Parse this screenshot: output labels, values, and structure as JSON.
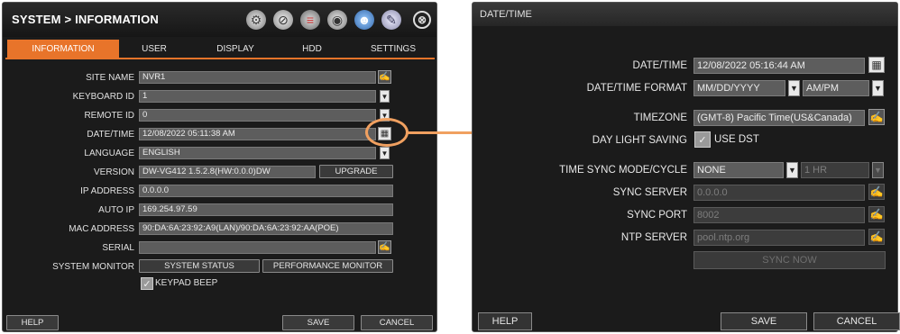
{
  "left": {
    "title": "SYSTEM > INFORMATION",
    "toolbar_icons": [
      "gear-icon",
      "network-icon",
      "database-icon",
      "record-icon",
      "user-icon",
      "tools-icon"
    ],
    "close_symbol": "⊗",
    "tabs": [
      {
        "label": "INFORMATION",
        "active": true
      },
      {
        "label": "USER",
        "active": false
      },
      {
        "label": "DISPLAY",
        "active": false
      },
      {
        "label": "HDD",
        "active": false
      },
      {
        "label": "SETTINGS",
        "active": false
      }
    ],
    "rows": {
      "site_name": {
        "label": "SITE NAME",
        "value": "NVR1"
      },
      "keyboard_id": {
        "label": "KEYBOARD ID",
        "value": "1"
      },
      "remote_id": {
        "label": "REMOTE ID",
        "value": "0"
      },
      "datetime": {
        "label": "DATE/TIME",
        "value": "12/08/2022 05:11:38 AM"
      },
      "language": {
        "label": "LANGUAGE",
        "value": "ENGLISH"
      },
      "version": {
        "label": "VERSION",
        "value": "DW-VG412 1.5.2.8(HW:0.0.0)DW",
        "button": "UPGRADE"
      },
      "ip_address": {
        "label": "IP ADDRESS",
        "value": "0.0.0.0"
      },
      "auto_ip": {
        "label": "AUTO IP",
        "value": "169.254.97.59"
      },
      "mac_address": {
        "label": "MAC ADDRESS",
        "value": "90:DA:6A:23:92:A9(LAN)/90:DA:6A:23:92:AA(POE)"
      },
      "serial": {
        "label": "SERIAL",
        "value": ""
      },
      "system_monitor": {
        "label": "SYSTEM MONITOR",
        "btn1": "SYSTEM STATUS",
        "btn2": "PERFORMANCE MONITOR"
      },
      "keypad_beep": {
        "label": "KEYPAD BEEP",
        "checked": true
      }
    },
    "footer": {
      "help": "HELP",
      "save": "SAVE",
      "cancel": "CANCEL"
    }
  },
  "right": {
    "title": "DATE/TIME",
    "rows": {
      "datetime": {
        "label": "DATE/TIME",
        "value": "12/08/2022 05:16:44 AM"
      },
      "format": {
        "label": "DATE/TIME FORMAT",
        "date_format": "MM/DD/YYYY",
        "time_format": "AM/PM"
      },
      "timezone": {
        "label": "TIMEZONE",
        "value": "(GMT-8) Pacific Time(US&Canada)"
      },
      "dst": {
        "label": "DAY LIGHT SAVING",
        "checkbox_label": "USE DST",
        "checked": true
      },
      "sync_mode": {
        "label": "TIME SYNC MODE/CYCLE",
        "mode": "NONE",
        "cycle": "1 HR"
      },
      "sync_server": {
        "label": "SYNC SERVER",
        "value": "0.0.0.0"
      },
      "sync_port": {
        "label": "SYNC PORT",
        "value": "8002"
      },
      "ntp_server": {
        "label": "NTP SERVER",
        "value": "pool.ntp.org"
      },
      "sync_now": "SYNC NOW"
    },
    "footer": {
      "help": "HELP",
      "save": "SAVE",
      "cancel": "CANCEL"
    }
  },
  "colors": {
    "accent": "#e8742a",
    "highlight": "#f0a060",
    "field_bg": "#5d5d5d",
    "window_bg": "#1b1b1b"
  }
}
